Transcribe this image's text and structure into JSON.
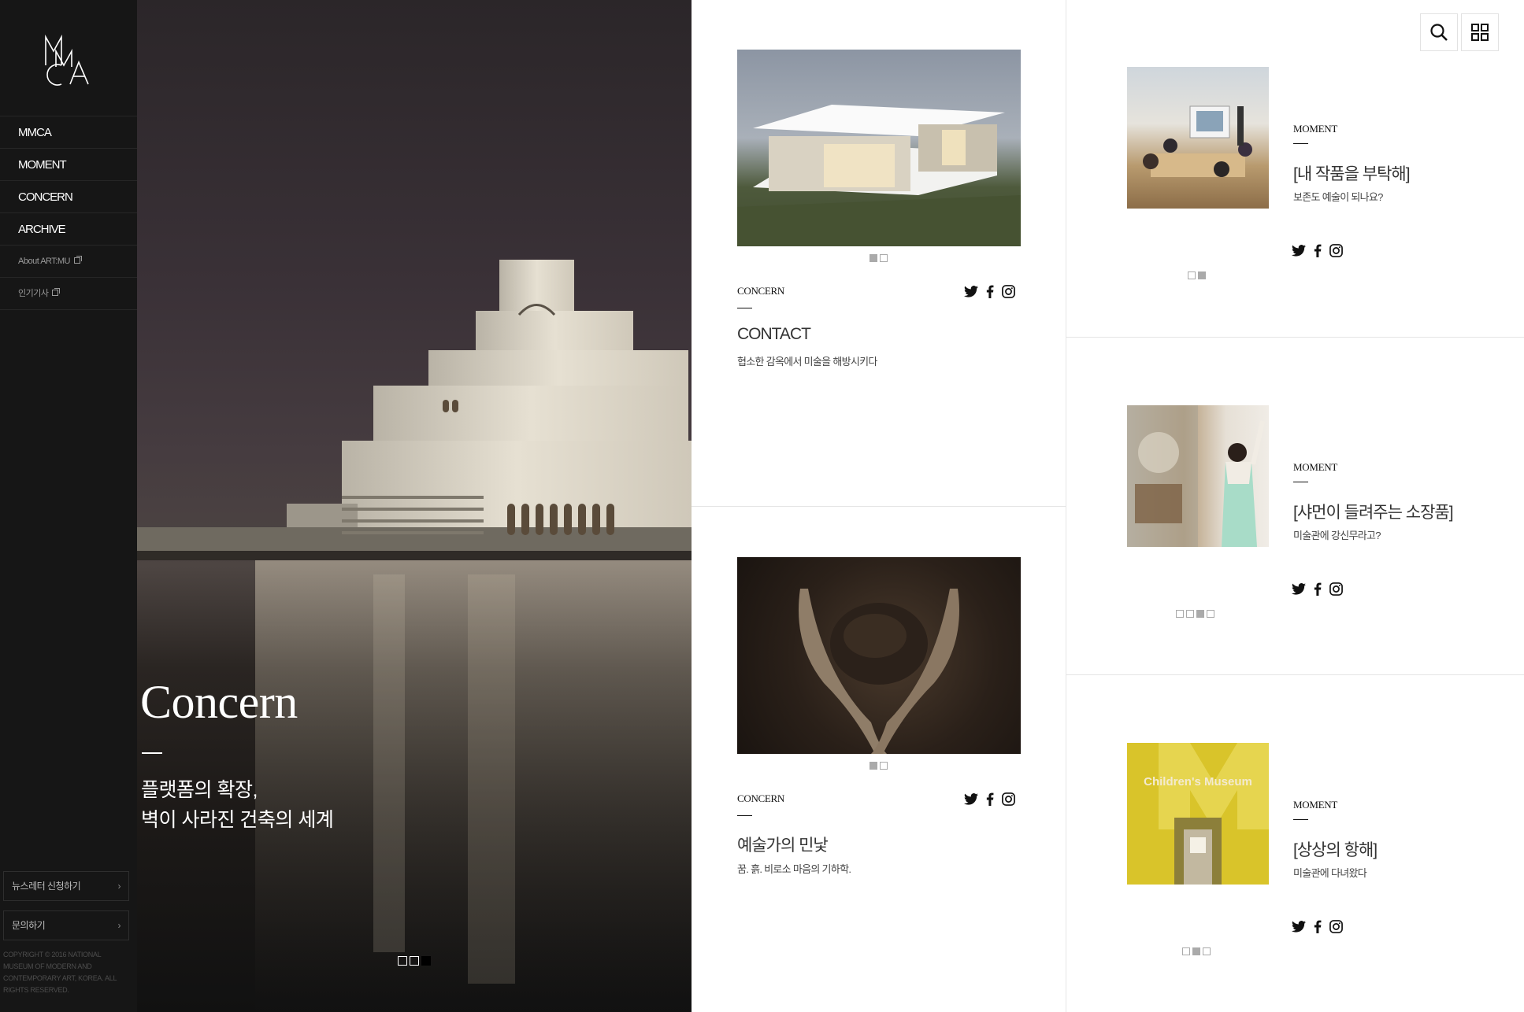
{
  "sidebar": {
    "logo_text": "MMCA",
    "nav": [
      {
        "label": "MMCA"
      },
      {
        "label": "MOMENT"
      },
      {
        "label": "CONCERN"
      },
      {
        "label": "ARCHIVE"
      },
      {
        "label": "About ART:MU"
      },
      {
        "label": "인기기사"
      }
    ],
    "newsletter_label": "뉴스레터 신청하기",
    "contact_label": "문의하기",
    "copyright": "COPYRIGHT © 2016 NATIONAL MUSEUM OF MODERN AND CONTEMPORARY ART, KOREA. ALL RIGHTS RESERVED."
  },
  "hero": {
    "title": "Concern",
    "subtitle_line1": "플랫폼의 확장,",
    "subtitle_line2": "벽이 사라진 건축의 세계",
    "slide_count": 3,
    "active_slide": 3
  },
  "cards_middle": [
    {
      "category": "CONCERN",
      "title": "CONTACT",
      "description": "협소한 감옥에서 미술을 해방시키다",
      "image": "white-modern-house-photo",
      "slides": 2,
      "active": 1
    },
    {
      "category": "CONCERN",
      "title": "예술가의 민낯",
      "description": "꿈. 흙. 비로소 마음의 기하학.",
      "image": "hands-holding-soil-photo",
      "slides": 2,
      "active": 1
    }
  ],
  "cards_right": [
    {
      "category": "MOMENT",
      "title": "[내 작품을 부탁해]",
      "description": "보존도 예술이 되나요?",
      "image": "classroom-workshop-photo",
      "slides": 2,
      "active": 2
    },
    {
      "category": "MOMENT",
      "title": "[샤먼이 들려주는 소장품]",
      "description": "미술관에 강신무라고?",
      "image": "shaman-performer-photo",
      "slides": 4,
      "active": 3
    },
    {
      "category": "MOMENT",
      "title": "[상상의 항해]",
      "description": "미술관에 다녀왔다",
      "image": "childrens-museum-entrance-photo",
      "slides": 3,
      "active": 2
    }
  ],
  "social": [
    "twitter-icon",
    "facebook-icon",
    "instagram-icon"
  ],
  "toolbar": {
    "search_icon": "search-icon",
    "grid_icon": "grid-menu-icon"
  },
  "kids_museum_sign": "Children's Museum"
}
